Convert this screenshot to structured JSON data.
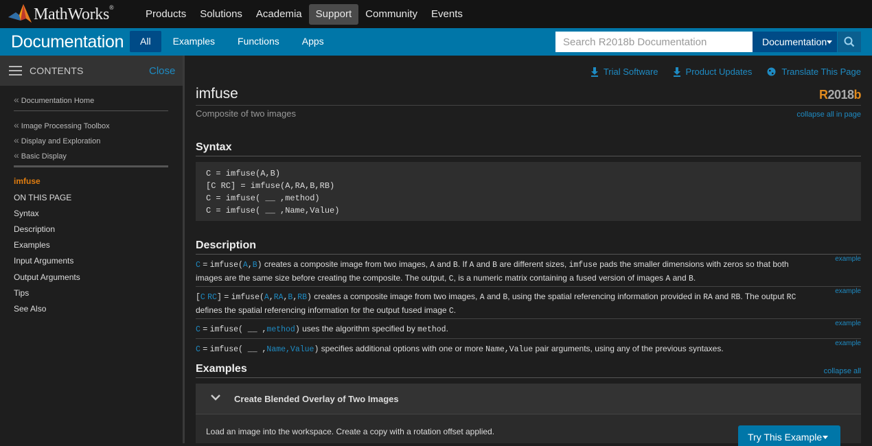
{
  "global_nav": {
    "logo_text": "MathWorks",
    "logo_mark": "®",
    "items": [
      "Products",
      "Solutions",
      "Academia",
      "Support",
      "Community",
      "Events"
    ],
    "active": "Support"
  },
  "doc_bar": {
    "title": "Documentation",
    "tabs": [
      "All",
      "Examples",
      "Functions",
      "Apps"
    ],
    "active_tab": "All",
    "search_placeholder": "Search R2018b Documentation",
    "search_scope": "Documentation",
    "accent_color": "#0076a8"
  },
  "sidebar": {
    "header_label": "CONTENTS",
    "close_label": "Close",
    "home_crumb": "Documentation Home",
    "crumbs": [
      "Image Processing Toolbox",
      "Display and Exploration",
      "Basic Display"
    ],
    "current": "imfuse",
    "on_this_page": "ON THIS PAGE",
    "items": [
      "Syntax",
      "Description",
      "Examples",
      "Input Arguments",
      "Output Arguments",
      "Tips",
      "See Also"
    ]
  },
  "utility_links": {
    "trial": "Trial Software",
    "updates": "Product Updates",
    "translate": "Translate This Page"
  },
  "page": {
    "title": "imfuse",
    "release_r": "R",
    "release_num": "2018",
    "release_b": "b",
    "purpose": "Composite of two images",
    "collapse_all_in_page": "collapse all in page",
    "syntax_heading": "Syntax",
    "syntax_lines": [
      "C = imfuse(A,B)",
      "[C RC] = imfuse(A,RA,B,RB)",
      "C = imfuse( __ ,method)",
      "C = imfuse( __ ,Name,Value)"
    ],
    "description_heading": "Description",
    "example_tag": "example",
    "examples_heading": "Examples",
    "collapse_all": "collapse all",
    "example_title": "Create Blended Overlay of Two Images",
    "example_text": "Load an image into the workspace. Create a copy with a rotation offset applied.",
    "try_button": "Try This Example"
  }
}
